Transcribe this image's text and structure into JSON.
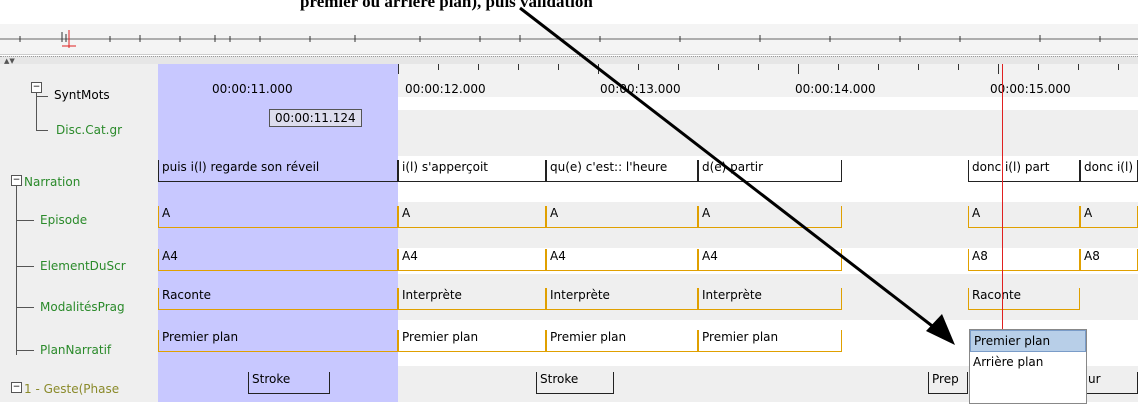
{
  "caption": "premier ou arrière plan), puis validation",
  "timeline": {
    "labels": [
      "00:00:11.000",
      "00:00:12.000",
      "00:00:13.000",
      "00:00:14.000",
      "00:00:15.000"
    ],
    "crosshair_time": "00:00:11.124"
  },
  "tiers": [
    {
      "name": "SyntMots",
      "color": "#2a8a2a"
    },
    {
      "name": "Disc.Cat.gr",
      "color": "#2a8a2a"
    },
    {
      "name": "Narration",
      "color": "#2a8a2a"
    },
    {
      "name": "Episode",
      "color": "#2a8a2a"
    },
    {
      "name": "ElementDuScr",
      "color": "#2a8a2a"
    },
    {
      "name": "ModalitésPrag",
      "color": "#2a8a2a"
    },
    {
      "name": "PlanNarratif",
      "color": "#2a8a2a"
    },
    {
      "name": "1 - Geste(Phase",
      "color": "#8a8a2a"
    }
  ],
  "narration": [
    "puis i(l) regarde son réveil",
    "i(l) s'apperçoit",
    "qu(e) c'est:: l'heure",
    "d(e) partir",
    "donc i(l) part",
    "donc i(l)"
  ],
  "episode": [
    "A",
    "A",
    "A",
    "A",
    "A",
    "A"
  ],
  "element": [
    "A4",
    "A4",
    "A4",
    "A4",
    "A8",
    "A8"
  ],
  "modalites": [
    "Raconte",
    "Interprète",
    "Interprète",
    "Interprète",
    "Raconte"
  ],
  "plan": [
    "Premier plan",
    "Premier plan",
    "Premier plan",
    "Premier plan"
  ],
  "geste": [
    "Stroke",
    "Stroke",
    "Prep",
    "ur"
  ],
  "dropdown": {
    "options": [
      "Premier plan",
      "Arrière plan"
    ]
  },
  "colors": {
    "selection": "#c8c8ff",
    "crosshair": "#e02020",
    "ref_annotation": "#e0a000"
  }
}
